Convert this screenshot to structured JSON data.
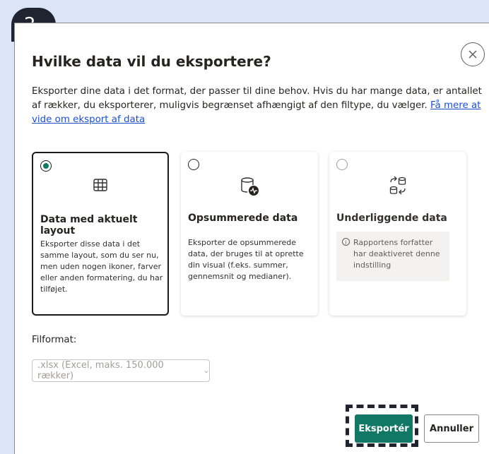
{
  "step": {
    "number": "2"
  },
  "dialog": {
    "title": "Hvilke data vil du eksportere?",
    "close_icon": "close-icon",
    "description": "Eksporter dine data i det format, der passer til dine behov. Hvis du har mange data, er antallet af rækker, du eksporterer, muligvis begrænset afhængigt af den filtype, du vælger.",
    "learn_more_link": "Få mere at vide om eksport af data"
  },
  "options": [
    {
      "title": "Data med aktuelt layout",
      "text": "Eksporter disse data i det samme layout, som du ser nu, men uden nogen ikoner, farver eller anden formatering, du har tilføjet.",
      "icon": "table-grid-icon",
      "state": "selected"
    },
    {
      "title": "Opsummerede data",
      "text": "Eksporter de opsummerede data, der bruges til at oprette din visual (f.eks. summer, gennemsnit og medianer).",
      "icon": "database-pulse-icon",
      "state": "unselected"
    },
    {
      "title": "Underliggende data",
      "info": "Rapportens forfatter har deaktiveret denne indstilling",
      "icon": "database-swap-icon",
      "state": "disabled"
    }
  ],
  "file_format": {
    "label": "Filformat:",
    "selected": ".xlsx (Excel, maks. 150.000 rækker)"
  },
  "footer": {
    "export_label": "Eksportér",
    "cancel_label": "Annuller"
  },
  "colors": {
    "accent": "#117865",
    "background": "#dbe5f7",
    "badge": "#1f2430",
    "link": "#1a4fcf"
  }
}
